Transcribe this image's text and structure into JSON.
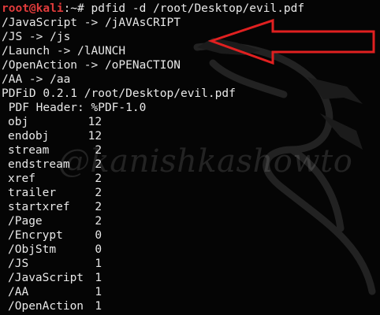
{
  "prompt": {
    "user_host": "root@kali",
    "path_symbol": ":~# ",
    "command": "pdfid -d /root/Desktop/evil.pdf"
  },
  "disarm_lines": [
    "/JavaScript -> /jAVAsCRIPT",
    "/JS -> /js",
    "/Launch -> /lAUNCH",
    "/OpenAction -> /oPENaCTION",
    "/AA -> /aa"
  ],
  "header": {
    "version_line": "PDFiD 0.2.1 /root/Desktop/evil.pdf",
    "pdf_header": " PDF Header: %PDF-1.0"
  },
  "rows": [
    {
      "key": "obj",
      "value": "12"
    },
    {
      "key": "endobj",
      "value": "12"
    },
    {
      "key": "stream",
      "value": "2"
    },
    {
      "key": "endstream",
      "value": "2"
    },
    {
      "key": "xref",
      "value": "2"
    },
    {
      "key": "trailer",
      "value": "2"
    },
    {
      "key": "startxref",
      "value": "2"
    },
    {
      "key": "/Page",
      "value": "2"
    },
    {
      "key": "/Encrypt",
      "value": "0"
    },
    {
      "key": "/ObjStm",
      "value": "0"
    },
    {
      "key": "/JS",
      "value": "1"
    },
    {
      "key": "/JavaScript",
      "value": "1"
    },
    {
      "key": "/AA",
      "value": "1"
    },
    {
      "key": "/OpenAction",
      "value": "1"
    }
  ],
  "watermark": "@kanishkashowto",
  "colors": {
    "background": "#050505",
    "text": "#e8e8e8",
    "prompt_user": "#e03b3b",
    "arrow": "#e02020"
  }
}
